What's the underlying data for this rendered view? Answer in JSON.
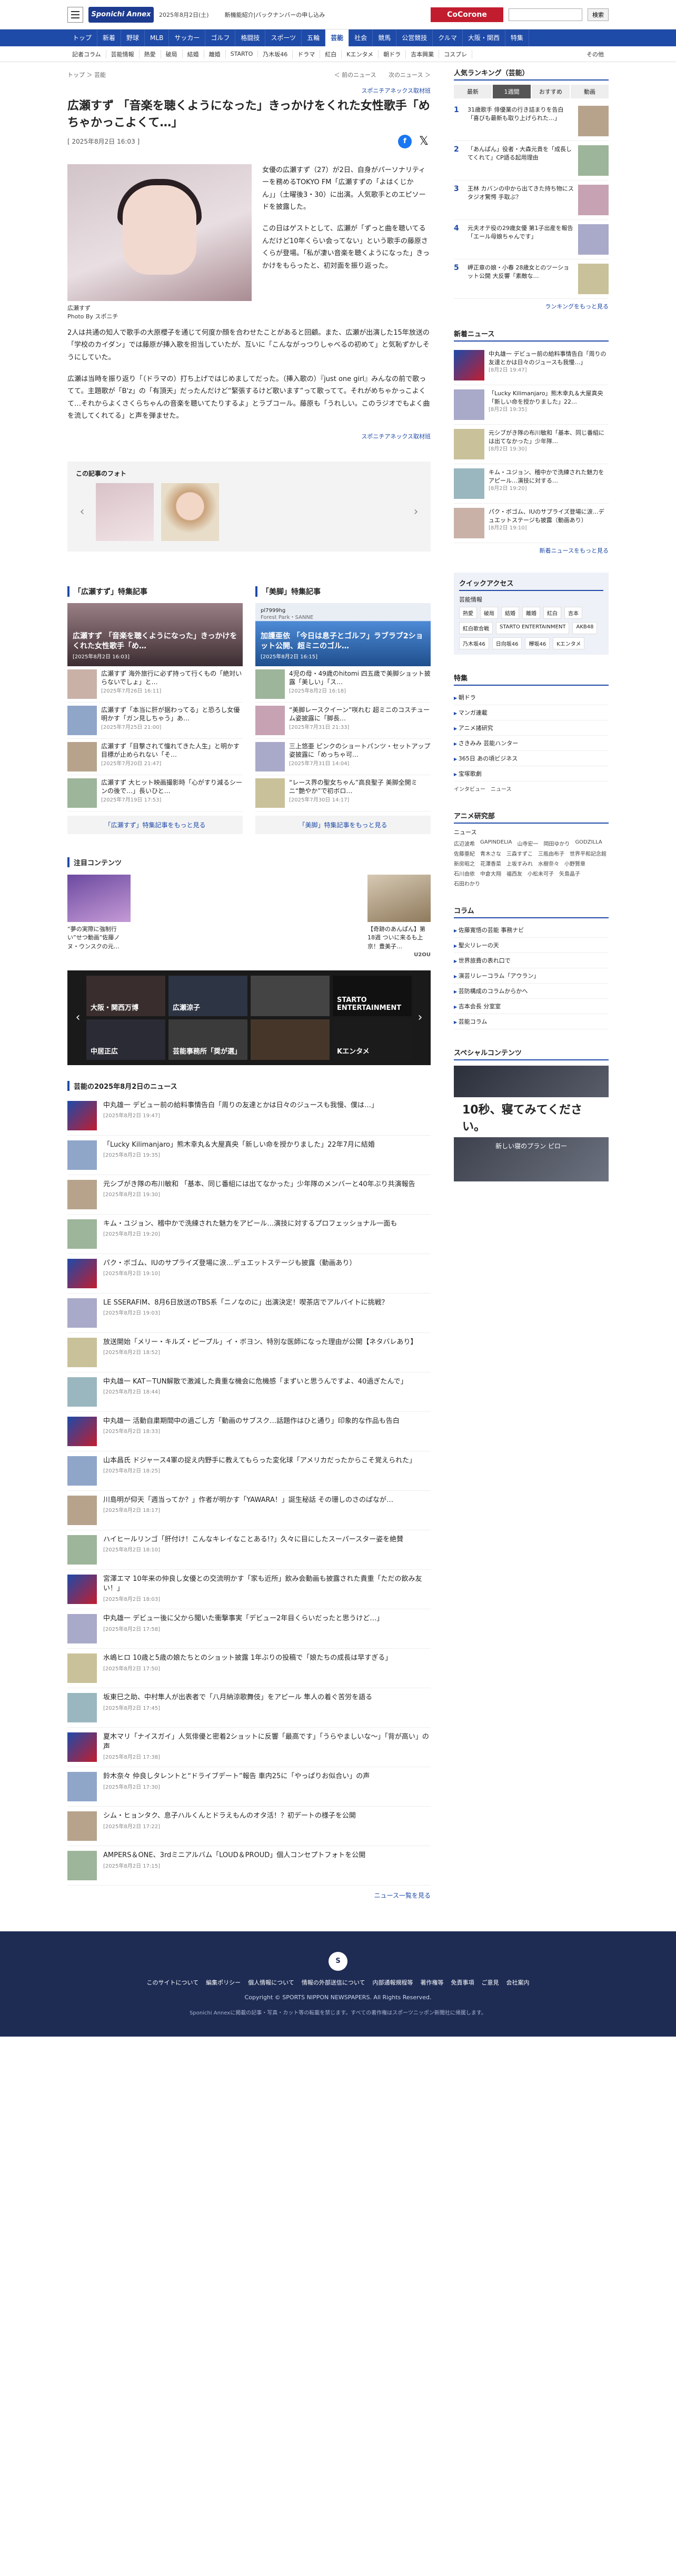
{
  "header": {
    "logo": "Sponichi Annex",
    "date": "2025年8月2日(土)",
    "notice": "新機能紹介|バックナンバーの申し込み",
    "promo": "CoCorone",
    "search_button": "検索"
  },
  "main_nav": [
    "トップ",
    "新着",
    "野球",
    "MLB",
    "サッカー",
    "ゴルフ",
    "格闘技",
    "スポーツ",
    "五輪",
    "芸能",
    "社会",
    "競馬",
    "公営競技",
    "クルマ",
    "大阪・関西",
    "特集"
  ],
  "sub_nav": [
    "記者コラム",
    "芸能情報",
    "熱愛",
    "破局",
    "結婚",
    "離婚",
    "STARTO",
    "乃木坂46",
    "ドラマ",
    "紅白",
    "Kエンタメ",
    "朝ドラ",
    "吉本興業",
    "コスプレ"
  ],
  "sub_nav_more": "その他",
  "breadcrumb": {
    "home": "トップ",
    "section": "芸能",
    "prev": "前のニュース",
    "next": "次のニュース"
  },
  "article": {
    "source": "スポニチアネックス取材班",
    "title": "広瀬すず 「音楽を聴くようになった」きっかけをくれた女性歌手「めちゃかっこよくて…」",
    "date": "[ 2025年8月2日 16:03 ]",
    "photo_caption": "広瀬すず",
    "photo_credit": "Photo By スポニチ",
    "paragraphs_side": [
      "女優の広瀬すず（27）が2日、自身がパーソナリティーを務めるTOKYO FM「広瀬すずの「よはくじかん」」（土曜後3・30）に出演。人気歌手とのエピソードを披露した。",
      "この日はゲストとして、広瀬が「ずっと曲を聴いてるんだけど10年くらい会ってない」という歌手の藤原さくらが登場。「私が凄い音楽を聴くようになった」きっかけをもらったと、初対面を振り返った。"
    ],
    "paragraphs_full": [
      "2人は共通の知人で歌手の大原櫻子を通じて何度か顔を合わせたことがあると回顧。また、広瀬が出演した15年放送の「学校のカイダン」では藤原が挿入歌を担当していたが、互いに「こんながっつりしゃべるの初めて」と気恥ずかしそうにしていた。",
      "広瀬は当時を振り返り「（ドラマの）打ち上げではじめましてだった。（挿入歌の）『just one girl』みんなの前で歌ってて。主題歌が「B'z」の「有頂天」だったんだけど“緊張するけど歌います”って歌ってて。それがめちゃかっこよくて…それからよくさくらちゃんの音楽を聴いてたりするよ」とラブコール。藤原も「うれしい。このラジオでもよく曲を流してくれてる」と声を弾ませた。"
    ],
    "source_bottom": "スポニチアネックス取材班"
  },
  "photos": {
    "title": "この記事のフォト"
  },
  "related": [
    {
      "title": "「広瀬すず」特集記事",
      "hero": "広瀬すず 「音楽を聴くようになった」きっかけをくれた女性歌手「め…",
      "hero_date": "[2025年8月2日 16:03]",
      "items": [
        {
          "text": "広瀬すず 海外旅行に必ず持って行くもの「絶対いらないでしょ」と…",
          "date": "[2025年7月26日 16:11]"
        },
        {
          "text": "広瀬すず「本当に肝が据わってる」と恐ろし女優明かす「ガン見しちゃう」あ…",
          "date": "[2025年7月25日 21:00]"
        },
        {
          "text": "広瀬すず「目撃されて憧れてきた人生」と明かす 目標が止められない「そ…",
          "date": "[2025年7月20日 21:47]"
        },
        {
          "text": "広瀬すず 大ヒット映画撮影時「心がすり減るシーンの後で…」長いひと…",
          "date": "[2025年7月19日 17:53]"
        }
      ],
      "more": "「広瀬すず」特集記事をもっと見る"
    },
    {
      "title": "「美脚」特集記事",
      "hero_account": "pl7999hg",
      "hero_account_sub": "Forest Park・SANNE",
      "hero": "加護亜依 「今日は息子とゴルフ」ラブラブ2ショット公開、超ミニのゴル…",
      "hero_date": "[2025年8月2日 16:15]",
      "items": [
        {
          "text": "4児の母・49歳のhitomi 四五歳で美脚ショット披露「美しい」「ス…",
          "date": "[2025年8月2日 16:18]"
        },
        {
          "text": "“美脚レースクイーン”咲れむ 超ミニのコスチューム姿披露に「脚長…",
          "date": "[2025年7月31日 21:33]"
        },
        {
          "text": "三上悠亜 ピンクのショートパンツ・セットアップ姿披露に「めっちゃ可…",
          "date": "[2025年7月31日 14:04]"
        },
        {
          "text": "“レース界の聖女ちゃん”高良聖子 美脚全開ミニ“艶やか”で初ボロ…",
          "date": "[2025年7月30日 14:17]"
        }
      ],
      "more": "「美脚」特集記事をもっと見る"
    }
  ],
  "chui": {
    "title": "注目コンテンツ",
    "left": "“夢の実際に強制行い”せつ動画”佐藤ノヌ・ウンスクの元…",
    "right": "【奇跡のあんぱん】第18週 ついに来るも上京！豊美子…",
    "brand": "U2OU"
  },
  "banner": {
    "cells": [
      "大阪・関西万博",
      "広瀬涼子",
      "",
      "STARTO ENTERTAINMENT",
      "中居正広",
      "芸能事務所「奨が選」",
      "",
      "Kエンタメ"
    ]
  },
  "news_day": {
    "title": "芸能の2025年8月2日のニュース",
    "items": [
      {
        "text": "中丸雄一 デビュー前の給料事情告白「周りの友達とかは日々のジュースも我慢、僕は…」",
        "date": "[2025年8月2日 19:47]"
      },
      {
        "text": "「Lucky Kilimanjaro」熊木幸丸＆大屋真央「新しい命を授かりました」22年7月に結婚",
        "date": "[2025年8月2日 19:35]"
      },
      {
        "text": "元シブがき隊の布川敏和 「基本、同じ番組には出てなかった」少年隊のメンバーと40年ぶり共演報告",
        "date": "[2025年8月2日 19:30]"
      },
      {
        "text": "キム・ユジョン、稽中かで洗練された魅力をアピール…演技に対するプロフェッショナル一面も",
        "date": "[2025年8月2日 19:20]"
      },
      {
        "text": "パク・ボゴム、IUのサプライズ登場に涙…デュエットステージも披露（動画あり）",
        "date": "[2025年8月2日 19:10]"
      },
      {
        "text": "LE SSERAFIM、8月6日放送のTBS系「ニノなのに」出演決定！喫茶店でアルバイトに挑戦？",
        "date": "[2025年8月2日 19:03]"
      },
      {
        "text": "放送開始「メリー・キルズ・ピープル」イ・ボヨン、特別な医師になった理由が公開【ネタバレあり】",
        "date": "[2025年8月2日 18:52]"
      },
      {
        "text": "中丸雄一 KAT－TUN解散で激減した貴重な機会に危機感「まずいと思うんですよ、40過ぎたんで」",
        "date": "[2025年8月2日 18:44]"
      },
      {
        "text": "中丸雄一 活動自粛期間中の過ごし方「動画のサブスク…話題作はひと通り」印象的な作品も告白",
        "date": "[2025年8月2日 18:33]"
      },
      {
        "text": "山本昌氏 ドジャース4軍の捉え内野手に教えてもらった変化球「アメリカだったからこそ覚えられた」",
        "date": "[2025年8月2日 18:25]"
      },
      {
        "text": "川島明が仰天「週当ってか？」作者が明かす「YAWARA！」誕生秘話 その珊しのさのぱなが…",
        "date": "[2025年8月2日 18:17]"
      },
      {
        "text": "ハイヒールリンゴ「肝付け！こんなキレイなことある!?」久々に目にしたスーパースター姿を絶賛",
        "date": "[2025年8月2日 18:10]"
      },
      {
        "text": "宮澤エマ 10年来の仲良し女優との交流明かす「家も近所」飲み会動画も披露された貴重「ただの飲み友い！」",
        "date": "[2025年8月2日 18:03]"
      },
      {
        "text": "中丸雄一 デビュー後に父から聞いた衝撃事実「デビュー2年目くらいだったと思うけど…」",
        "date": "[2025年8月2日 17:58]"
      },
      {
        "text": "水嶋ヒロ 10歳と5歳の娘たちとのショット披露 1年ぶりの投稿で「娘たちの成長は早すぎる」",
        "date": "[2025年8月2日 17:50]"
      },
      {
        "text": "坂東巳之助、中村隼人が出表者で「八月納涼歌舞伎」をアピール 隼人の着ぐ苦労を語る",
        "date": "[2025年8月2日 17:45]"
      },
      {
        "text": "夏木マリ「ナイスガイ」人気俳優と密着2ショットに反響「最高です」「うらやましいな～」「背が高い」の声",
        "date": "[2025年8月2日 17:38]"
      },
      {
        "text": "鈴木奈々 仲良しタレントと“ドライブデート”報告 車内25に「やっぱりお似合い」の声",
        "date": "[2025年8月2日 17:30]"
      },
      {
        "text": "シム・ヒョンタク、息子ハルくんとドラえもんのオタ活！？初デートの様子を公開",
        "date": "[2025年8月2日 17:22]"
      },
      {
        "text": "AMPERS＆ONE、3rdミニアルバム「LOUD＆PROUD」個人コンセプトフォトを公開",
        "date": "[2025年8月2日 17:15]"
      }
    ],
    "more": "ニュース一覧を見る"
  },
  "sidebar": {
    "ranking_title": "人気ランキング（芸能）",
    "ranking_tabs": [
      "最新",
      "1週間",
      "おすすめ",
      "動画"
    ],
    "ranking": [
      {
        "no": "1",
        "text": "31歳歌手 俳優業の行き詰まりを告白「喜びも最新も取り上げられた…」"
      },
      {
        "text": "「あんぱん」役者・大森元貴を「成長してくれて」CP語る起用理由",
        "no": "2"
      },
      {
        "no": "3",
        "text": "王林 カバンの中から出てきた持ち物にスタジオ驚愕 手取ぶ？"
      },
      {
        "no": "4",
        "text": "元夫オテ役の29歳女優 第1子出産を報告「エール母娘ちゃんです」"
      },
      {
        "no": "5",
        "text": "岬正章の娘・小春 28歳女とのツーショット公開 大反響「素敵な…"
      }
    ],
    "ranking_more": "ランキングをもっと見る",
    "new_title": "新着ニュース",
    "new": [
      {
        "text": "中丸雄一 デビュー前の給料事情告白「周りの友達とかは日々のジュースも我慢…」",
        "date": "[8月2日 19:47]"
      },
      {
        "text": "「Lucky Kilimanjaro」熊木幸丸＆大屋真央「新しい命を授かりました」22…",
        "date": "[8月2日 19:35]"
      },
      {
        "text": "元シブがき隊の布川敏和「基本、同じ番組には出てなかった」少年隊…",
        "date": "[8月2日 19:30]"
      },
      {
        "text": "キム・ユジョン、稽中かで洗練された魅力をアピール…演技に対する…",
        "date": "[8月2日 19:20]"
      },
      {
        "text": "パク・ボゴム、IUのサプライズ登場に涙…デュエットステージも披露（動画あり）",
        "date": "[8月2日 19:10]"
      }
    ],
    "new_more": "新着ニュースをもっと見る",
    "quick_title": "クイックアクセス",
    "quick_sub": "芸能情報",
    "quick_tags": [
      "熱愛",
      "破局",
      "結婚",
      "離婚",
      "紅白",
      "吉本",
      "紅白歌合戦",
      "STARTO ENTERTAINMENT",
      "AKB48",
      "乃木坂46",
      "日向坂46",
      "欅坂46",
      "Kエンタメ"
    ],
    "feature_title": "特集",
    "features": [
      "朝ドラ",
      "マンガ連載",
      "アニメ諸研究",
      "さきみみ 芸能ハンター",
      "365日 あの頃ビジネス",
      "宝塚歌劇"
    ],
    "feature_tags": [
      "インタビュー",
      "ニュース"
    ],
    "anime_title": "アニメ研究部",
    "anime_sub": "ニュース",
    "anime_tags": [
      "広辺波希",
      "GAPINDELIA",
      "山寺宏一",
      "岡田ゆかり",
      "GODZILLA",
      "佐藤亜紀",
      "青木さな",
      "三森すずこ",
      "三瓶由布子",
      "世界平和記念館",
      "新房昭之",
      "花澤香菜",
      "上坂すみれ",
      "水樹奈々",
      "小野賢章",
      "石川由依",
      "中倉大翔",
      "福西友",
      "小松未可子",
      "矢島晶子",
      "石田わかり"
    ],
    "column_title": "コラム",
    "columns": [
      "佐藤寛悟の芸能 事務ナビ",
      "聖火リレーの天",
      "世界旅費の表れ口で",
      "演芸リレーコラム「アウラン」",
      "芸防構成のコラムからかへ",
      "吉本会長 分室室",
      "芸能コラム"
    ],
    "special_title": "スペシャルコンテンツ",
    "special_ad": "10秒、寝てみてください。",
    "special_ad_sub": "新しい寝のプラン ピロー"
  },
  "footer": {
    "logo": "S",
    "links": [
      "このサイトについて",
      "編集ポリシー",
      "個人情報について",
      "情報の外部送信について",
      "内部通報規程等",
      "著作権等",
      "免責事項",
      "ご意見",
      "会社案内"
    ],
    "copyright": "Copyright © SPORTS NIPPON NEWSPAPERS. All Rights Reserved.",
    "note": "Sponichi Annexに掲載の記事・写真・カット等の転載を禁じます。すべての著作権はスポーツニッポン新聞社に帰属します。"
  },
  "colors": {
    "brand": "#1e4aa8",
    "promo": "#c21d2f",
    "footer": "#1e2c54"
  }
}
